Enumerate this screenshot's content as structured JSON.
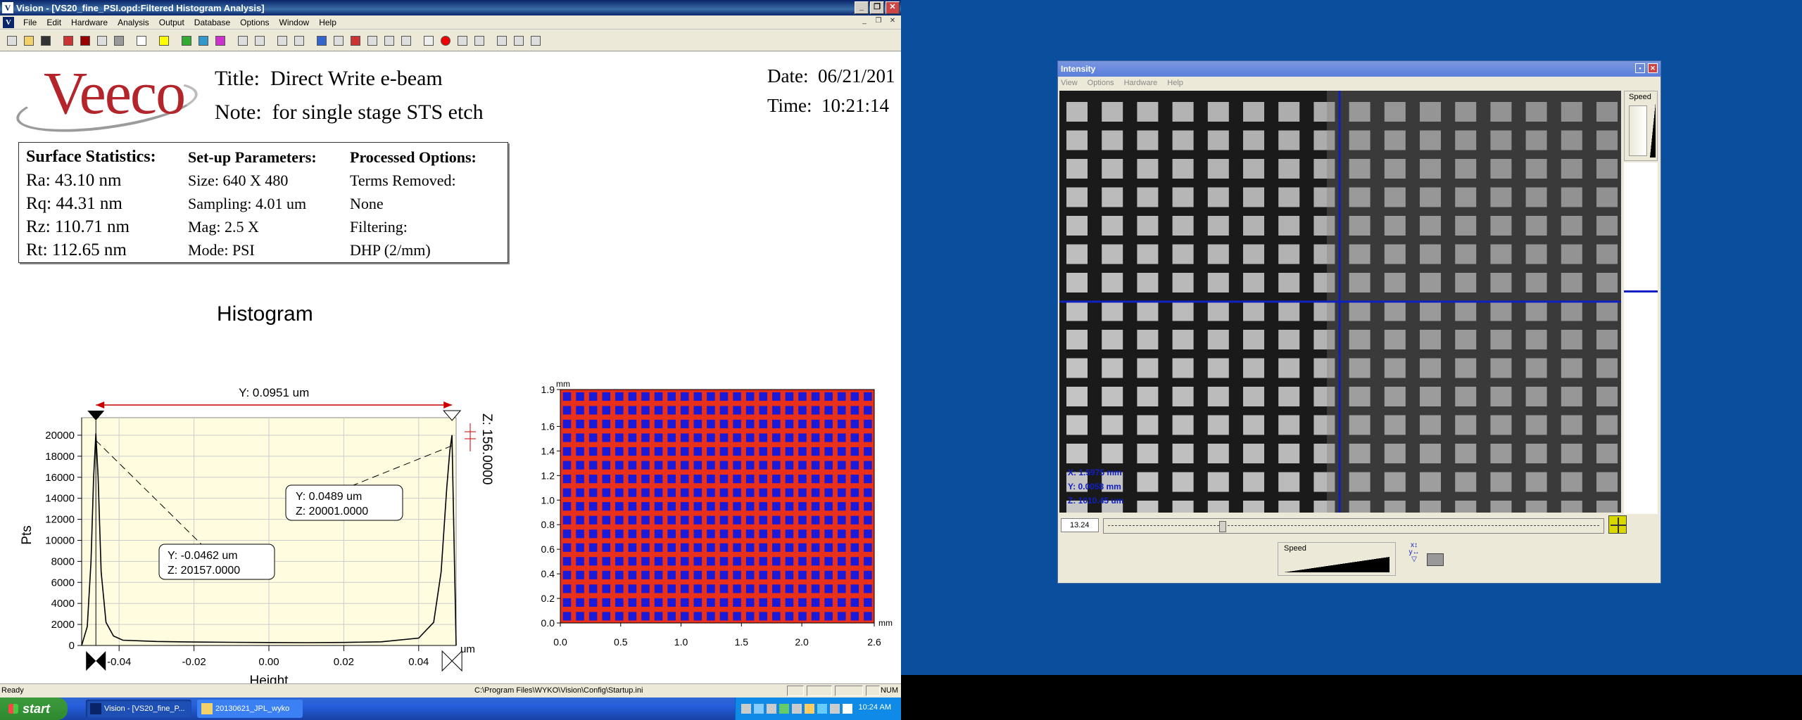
{
  "main_window": {
    "title": "Vision - [VS20_fine_PSI.opd:Filtered Histogram Analysis]",
    "menu": [
      "File",
      "Edit",
      "Hardware",
      "Analysis",
      "Output",
      "Database",
      "Options",
      "Window",
      "Help"
    ]
  },
  "report": {
    "logo_text": "Veeco",
    "title_label": "Title:",
    "title_value": "Direct Write e-beam",
    "note_label": "Note:",
    "note_value": "for single stage STS etch",
    "date_label": "Date:",
    "date_value": "06/21/201",
    "time_label": "Time:",
    "time_value": "10:21:14",
    "surface_stats": {
      "heading": "Surface Statistics:",
      "rows": [
        "Ra:  43.10 nm",
        "Rq:  44.31 nm",
        "Rz:  110.71 nm",
        "Rt:  112.65 nm"
      ]
    },
    "setup_params": {
      "heading": "Set-up Parameters:",
      "rows": [
        "Size: 640 X 480",
        "Sampling:  4.01 um",
        "Mag:  2.5 X",
        "Mode:  PSI"
      ]
    },
    "processed_options": {
      "heading": "Processed Options:",
      "rows": [
        "Terms Removed:",
        "None",
        "Filtering:",
        "DHP (2/mm)"
      ]
    }
  },
  "chart_data": [
    {
      "type": "line",
      "title": "Histogram",
      "xlabel": "Height",
      "ylabel": "Pts",
      "x_unit": "um",
      "xlim": [
        -0.05,
        0.05
      ],
      "ylim": [
        0,
        21000
      ],
      "x_ticks": [
        "-0.04",
        "-0.02",
        "0.00",
        "0.02",
        "0.04"
      ],
      "y_ticks": [
        "0",
        "2000",
        "4000",
        "6000",
        "8000",
        "10000",
        "12000",
        "14000",
        "16000",
        "18000",
        "20000"
      ],
      "series": [
        {
          "x": [
            -0.05,
            -0.0485,
            -0.0475,
            -0.0468,
            -0.0462,
            -0.0456,
            -0.0448,
            -0.0435,
            -0.0415,
            -0.039,
            -0.03,
            -0.02,
            -0.01,
            0.0,
            0.01,
            0.02,
            0.03,
            0.04,
            0.044,
            0.046,
            0.0475,
            0.0483,
            0.0489,
            0.0495,
            0.05
          ],
          "y": [
            0,
            1800,
            8000,
            16000,
            20157,
            16000,
            7000,
            2200,
            900,
            500,
            380,
            330,
            300,
            280,
            270,
            290,
            350,
            700,
            2200,
            7000,
            15000,
            18500,
            20001,
            9000,
            0
          ]
        }
      ],
      "annotations": {
        "span_label": "Y: 0.0951 um",
        "z_label": "Z: 156.0000",
        "peak_left": [
          "Y: -0.0462 um",
          "Z: 20157.0000"
        ],
        "peak_right": [
          "Y: 0.0489 um",
          "Z: 20001.0000"
        ]
      }
    },
    {
      "type": "heatmap",
      "x_unit": "mm",
      "y_unit": "mm",
      "xlim": [
        0.0,
        2.6
      ],
      "ylim": [
        0.0,
        1.9
      ],
      "x_ticks": [
        "0.0",
        "0.5",
        "1.0",
        "1.5",
        "2.0",
        "2.6"
      ],
      "y_ticks": [
        "0.0",
        "0.2",
        "0.4",
        "0.6",
        "0.8",
        "1.0",
        "1.2",
        "1.4",
        "1.6",
        "1.9"
      ],
      "grid_cols": 24,
      "grid_rows": 17,
      "colors": {
        "background": "#e8301a",
        "squares": "#1a1ad8"
      }
    }
  ],
  "status": {
    "left": "Ready",
    "path": "C:\\Program Files\\WYKO\\Vision\\Config\\Startup.ini",
    "num": "NUM"
  },
  "intensity_window": {
    "title": "Intensity",
    "menu": [
      "View",
      "Options",
      "Hardware",
      "Help"
    ],
    "speed_label": "Speed",
    "overlay_lines": [
      "X: 1.5975 mm",
      "Y: 0.0058 mm",
      "Z: 1010.45 um"
    ],
    "slider_value": "13.24",
    "speed2_label": "Speed",
    "xy_icon": "xy-toggle-icon"
  },
  "taskbar": {
    "start_label": "start",
    "tasks": [
      "Vision - [VS20_fine_P...",
      "20130621_JPL_wyko"
    ],
    "clock": "10:24 AM"
  }
}
